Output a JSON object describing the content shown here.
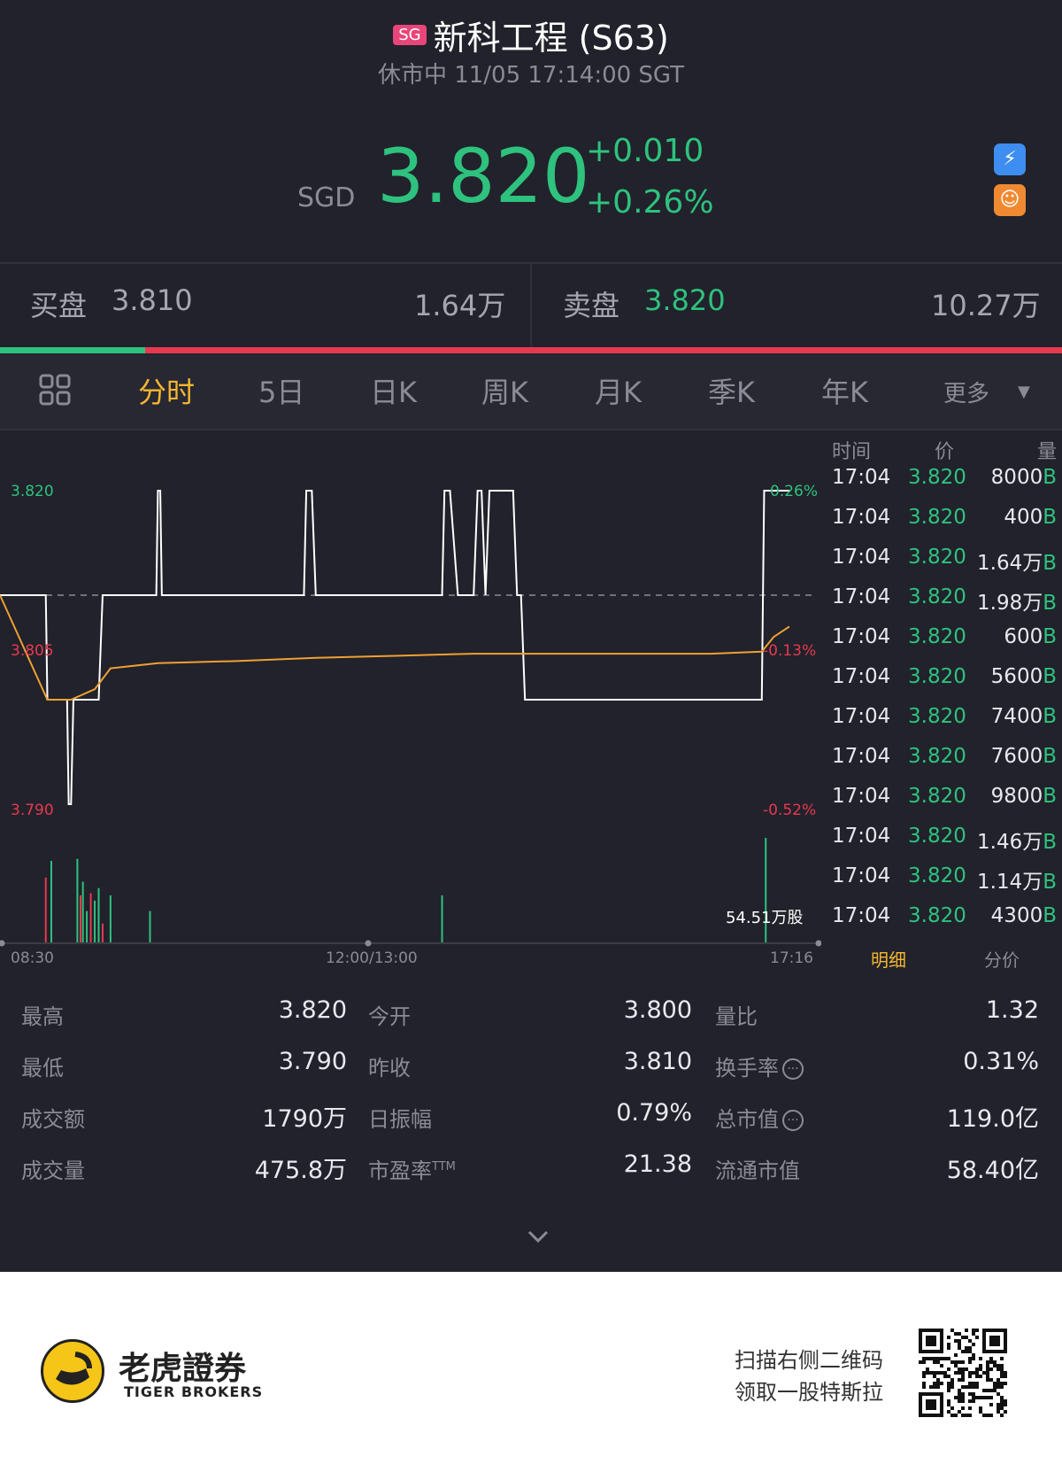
{
  "header": {
    "market_badge": "SG",
    "title": "新科工程 (S63)",
    "status": "休市中 11/05 17:14:00 SGT",
    "currency": "SGD",
    "price": "3.820",
    "change": "+0.010",
    "change_pct": "+0.26%",
    "side_icons": [
      "lightning-icon",
      "tiger-coin-icon"
    ]
  },
  "orderbook": {
    "bid_label": "买盘",
    "bid_price": "3.810",
    "bid_volume": "1.64万",
    "ask_label": "卖盘",
    "ask_price": "3.820",
    "ask_volume": "10.27万",
    "bid_ratio": 0.137
  },
  "tabs": {
    "grid_icon": "grid-icon",
    "items": [
      "分时",
      "5日",
      "日K",
      "周K",
      "月K",
      "季K",
      "年K",
      "更多"
    ],
    "active": "分时",
    "more_icon": "dropdown-triangle-icon"
  },
  "colors": {
    "up": "#2ec27e",
    "down": "#e8384f",
    "accent": "#f5b731",
    "avg_line": "#f0a033",
    "price_line": "#ffffff"
  },
  "chart_data": {
    "type": "line",
    "title": "",
    "y_labels": {
      "top": "3.820",
      "mid": "3.805",
      "bottom": "3.790"
    },
    "pct_labels": {
      "top": "0.26%",
      "mid": "-0.13%",
      "bottom": "-0.52%"
    },
    "ylim": [
      3.79,
      3.82
    ],
    "prev_close": 3.81,
    "x_labels": [
      "08:30",
      "12:00/13:00",
      "17:16"
    ],
    "volume_label": "54.51万股",
    "price_series": {
      "t": [
        0,
        0.058,
        0.06,
        0.085,
        0.087,
        0.09,
        0.093,
        0.1,
        0.105,
        0.11,
        0.125,
        0.13,
        0.198,
        0.2,
        0.203,
        0.205,
        0.385,
        0.388,
        0.395,
        0.4,
        0.56,
        0.563,
        0.57,
        0.58,
        0.6,
        0.605,
        0.61,
        0.615,
        0.62,
        0.65,
        0.655,
        0.66,
        0.665,
        0.67,
        0.965,
        0.968,
        0.98,
        1.0
      ],
      "v": [
        3.81,
        3.81,
        3.8,
        3.8,
        3.79,
        3.79,
        3.8,
        3.8,
        3.8,
        3.8,
        3.8,
        3.81,
        3.81,
        3.82,
        3.82,
        3.81,
        3.81,
        3.82,
        3.82,
        3.81,
        3.81,
        3.82,
        3.82,
        3.81,
        3.81,
        3.82,
        3.82,
        3.81,
        3.82,
        3.82,
        3.81,
        3.81,
        3.8,
        3.8,
        3.8,
        3.82,
        3.82,
        3.82
      ]
    },
    "avg_series": {
      "t": [
        0,
        0.06,
        0.09,
        0.12,
        0.14,
        0.2,
        0.3,
        0.4,
        0.5,
        0.6,
        0.7,
        0.8,
        0.9,
        0.965,
        0.98,
        1.0
      ],
      "v": [
        3.81,
        3.8,
        3.8,
        3.801,
        3.803,
        3.8035,
        3.8037,
        3.804,
        3.8042,
        3.8044,
        3.8044,
        3.8044,
        3.8044,
        3.8046,
        3.806,
        3.807
      ]
    },
    "volume_series": {
      "t": [
        0.058,
        0.065,
        0.098,
        0.102,
        0.105,
        0.11,
        0.115,
        0.12,
        0.125,
        0.13,
        0.14,
        0.19,
        0.56,
        0.97
      ],
      "v": [
        0.62,
        0.78,
        0.8,
        0.45,
        0.58,
        0.3,
        0.47,
        0.4,
        0.52,
        0.18,
        0.45,
        0.3,
        0.45,
        1.0
      ],
      "up": [
        false,
        true,
        true,
        false,
        true,
        true,
        false,
        true,
        true,
        false,
        true,
        true,
        true,
        true
      ]
    }
  },
  "ticks": {
    "headers": [
      "时间",
      "价",
      "量"
    ],
    "rows": [
      {
        "time": "17:04",
        "price": "3.820",
        "vol": "8000"
      },
      {
        "time": "17:04",
        "price": "3.820",
        "vol": "400"
      },
      {
        "time": "17:04",
        "price": "3.820",
        "vol": "1.64万"
      },
      {
        "time": "17:04",
        "price": "3.820",
        "vol": "1.98万"
      },
      {
        "time": "17:04",
        "price": "3.820",
        "vol": "600"
      },
      {
        "time": "17:04",
        "price": "3.820",
        "vol": "5600"
      },
      {
        "time": "17:04",
        "price": "3.820",
        "vol": "7400"
      },
      {
        "time": "17:04",
        "price": "3.820",
        "vol": "7600"
      },
      {
        "time": "17:04",
        "price": "3.820",
        "vol": "9800"
      },
      {
        "time": "17:04",
        "price": "3.820",
        "vol": "1.46万"
      },
      {
        "time": "17:04",
        "price": "3.820",
        "vol": "1.14万"
      },
      {
        "time": "17:04",
        "price": "3.820",
        "vol": "4300"
      }
    ],
    "side_marker": "B",
    "tab_detail": "明细",
    "tab_price": "分价"
  },
  "stats": [
    [
      {
        "label": "最高",
        "value": "3.820"
      },
      {
        "label": "今开",
        "value": "3.800"
      },
      {
        "label": "量比",
        "value": "1.32"
      }
    ],
    [
      {
        "label": "最低",
        "value": "3.790"
      },
      {
        "label": "昨收",
        "value": "3.810"
      },
      {
        "label": "换手率",
        "value": "0.31%",
        "info": true
      }
    ],
    [
      {
        "label": "成交额",
        "value": "1790万"
      },
      {
        "label": "日振幅",
        "value": "0.79%"
      },
      {
        "label": "总市值",
        "value": "119.0亿",
        "info": true
      }
    ],
    [
      {
        "label": "成交量",
        "value": "475.8万"
      },
      {
        "label": "市盈率",
        "sup": "TTM",
        "value": "21.38"
      },
      {
        "label": "流通市值",
        "value": "58.40亿"
      }
    ]
  ],
  "expand_icon": "chevron-down-icon",
  "footer": {
    "brand_cn": "老虎證券",
    "brand_en": "TIGER BROKERS",
    "promo_line1": "扫描右侧二维码",
    "promo_line2": "领取一股特斯拉"
  }
}
